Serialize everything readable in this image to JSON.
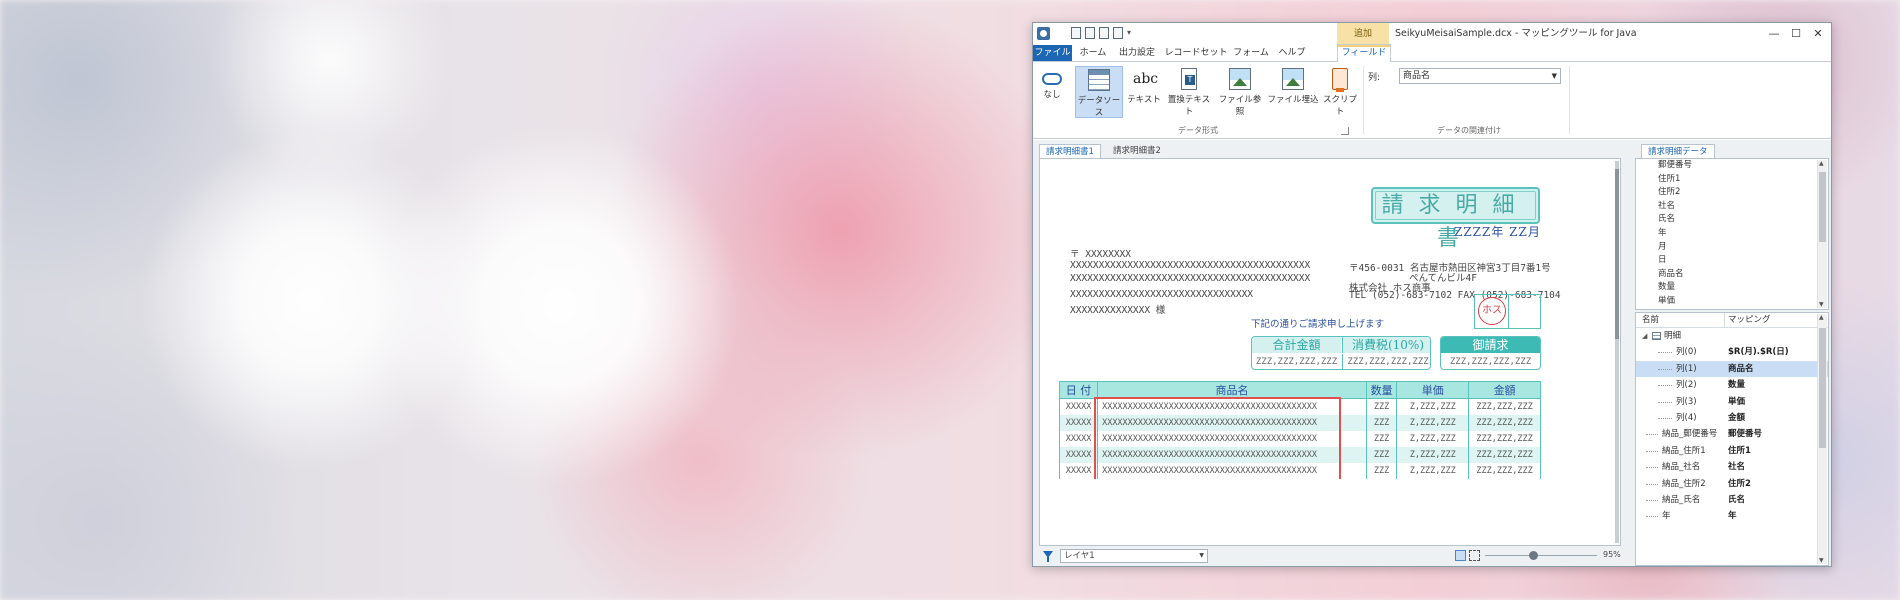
{
  "window": {
    "title": "SeikyuMeisaiSample.dcx - マッピングツール for Java",
    "context_tab_group": "追加",
    "controls": [
      "—",
      "☐",
      "✕"
    ]
  },
  "ribbon_tabs": [
    "ファイル",
    "ホーム",
    "出力設定",
    "レコードセット",
    "フォーム",
    "ヘルプ",
    "フィールド"
  ],
  "ribbon": {
    "buttons": [
      {
        "label": "なし",
        "icon": "link-icon"
      },
      {
        "label": "データソース",
        "icon": "datasource-table-icon"
      },
      {
        "label": "テキスト",
        "icon": "abc-text-icon"
      },
      {
        "label": "置換テキスト",
        "icon": "replace-text-icon"
      },
      {
        "label": "ファイル参照",
        "icon": "file-ref-image-icon"
      },
      {
        "label": "ファイル埋込",
        "icon": "file-embed-image-icon"
      },
      {
        "label": "スクリプト",
        "icon": "script-icon"
      }
    ],
    "group_data_format": "データ形式",
    "column_label": "列:",
    "column_value": "商品名",
    "group_data_link": "データの関連付け"
  },
  "doc_tabs": [
    "請求明細書1",
    "請求明細書2"
  ],
  "invoice": {
    "title": "請求明細書",
    "date": "ZZZZ年 ZZ月",
    "postal": "〒 XXXXXXXX",
    "addr1": "XXXXXXXXXXXXXXXXXXXXXXXXXXXXXXXXXXXXXXXXXX",
    "addr2": "XXXXXXXXXXXXXXXXXXXXXXXXXXXXXXXXXXXXXXXXXX",
    "company": "XXXXXXXXXXXXXXXXXXXXXXXXXXXXXXXX",
    "person": "XXXXXXXXXXXXXX 様",
    "issuer_addr1": "〒456-0031 名古屋市熱田区神宮3丁目7番1号",
    "issuer_addr2": "ぺんてんビル4F",
    "issuer_name": "株式会社 ホス商事",
    "issuer_tel": "TEL (052)-683-7102 FAX (052)-683-7104",
    "seal": "ホス",
    "notice": "下記の通りご請求申し上げます",
    "total_label": "合計金額",
    "tax_label": "消費税(10%)",
    "total_value": "ZZZ,ZZZ,ZZZ,ZZZ",
    "tax_value": "ZZZ,ZZZ,ZZZ,ZZZ",
    "bill_label": "御請求",
    "bill_value": "ZZZ,ZZZ,ZZZ,ZZZ",
    "table": {
      "headers": [
        "日 付",
        "商品名",
        "数量",
        "単価",
        "金額"
      ],
      "rows": [
        [
          "XXXXX",
          "XXXXXXXXXXXXXXXXXXXXXXXXXXXXXXXXXXXXXXXXXX",
          "ZZZ",
          "Z,ZZZ,ZZZ",
          "ZZZ,ZZZ,ZZZ"
        ],
        [
          "XXXXX",
          "XXXXXXXXXXXXXXXXXXXXXXXXXXXXXXXXXXXXXXXXXX",
          "ZZZ",
          "Z,ZZZ,ZZZ",
          "ZZZ,ZZZ,ZZZ"
        ],
        [
          "XXXXX",
          "XXXXXXXXXXXXXXXXXXXXXXXXXXXXXXXXXXXXXXXXXX",
          "ZZZ",
          "Z,ZZZ,ZZZ",
          "ZZZ,ZZZ,ZZZ"
        ],
        [
          "XXXXX",
          "XXXXXXXXXXXXXXXXXXXXXXXXXXXXXXXXXXXXXXXXXX",
          "ZZZ",
          "Z,ZZZ,ZZZ",
          "ZZZ,ZZZ,ZZZ"
        ],
        [
          "XXXXX",
          "XXXXXXXXXXXXXXXXXXXXXXXXXXXXXXXXXXXXXXXXXX",
          "ZZZ",
          "Z,ZZZ,ZZZ",
          "ZZZ,ZZZ,ZZZ"
        ]
      ]
    }
  },
  "statusbar": {
    "layer": "レイヤ1",
    "zoom": "95%"
  },
  "right_panel": {
    "tab": "請求明細データ",
    "fields": [
      "郵便番号",
      "住所1",
      "住所2",
      "社名",
      "氏名",
      "年",
      "月",
      "日",
      "商品名",
      "数量",
      "単価"
    ],
    "mapping_headers": [
      "名前",
      "マッピング"
    ],
    "mapping_rows": [
      {
        "name": "明細",
        "mapping": ""
      },
      {
        "name": "列(0)",
        "mapping": "$R(月).$R(日)"
      },
      {
        "name": "列(1)",
        "mapping": "商品名"
      },
      {
        "name": "列(2)",
        "mapping": "数量"
      },
      {
        "name": "列(3)",
        "mapping": "単価"
      },
      {
        "name": "列(4)",
        "mapping": "金額"
      },
      {
        "name": "納品_郵便番号",
        "mapping": "郵便番号"
      },
      {
        "name": "納品_住所1",
        "mapping": "住所1"
      },
      {
        "name": "納品_社名",
        "mapping": "社名"
      },
      {
        "name": "納品_住所2",
        "mapping": "住所2"
      },
      {
        "name": "納品_氏名",
        "mapping": "氏名"
      },
      {
        "name": "年",
        "mapping": "年"
      }
    ]
  }
}
